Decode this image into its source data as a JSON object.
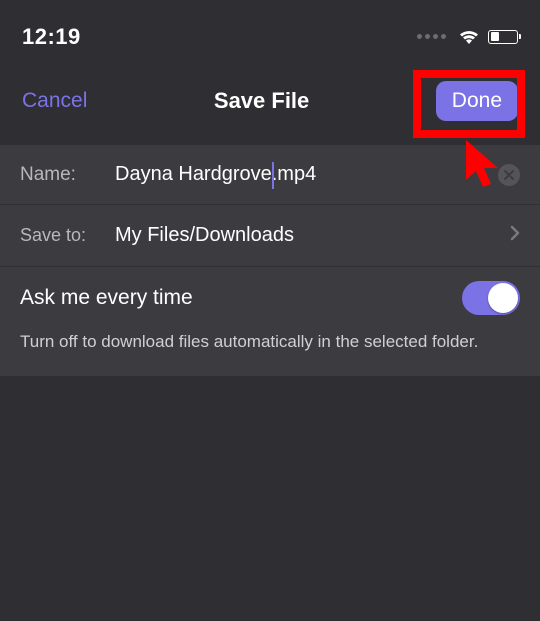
{
  "status": {
    "time": "12:19"
  },
  "nav": {
    "cancel": "Cancel",
    "title": "Save File",
    "done": "Done"
  },
  "name_row": {
    "label": "Name:",
    "value_before_caret": "Dayna Hardgrove",
    "value_after_caret": ".mp4"
  },
  "saveto_row": {
    "label": "Save to:",
    "value": "My Files/Downloads"
  },
  "ask": {
    "label": "Ask me every time",
    "description": "Turn off to download files automatically in the selected folder."
  }
}
